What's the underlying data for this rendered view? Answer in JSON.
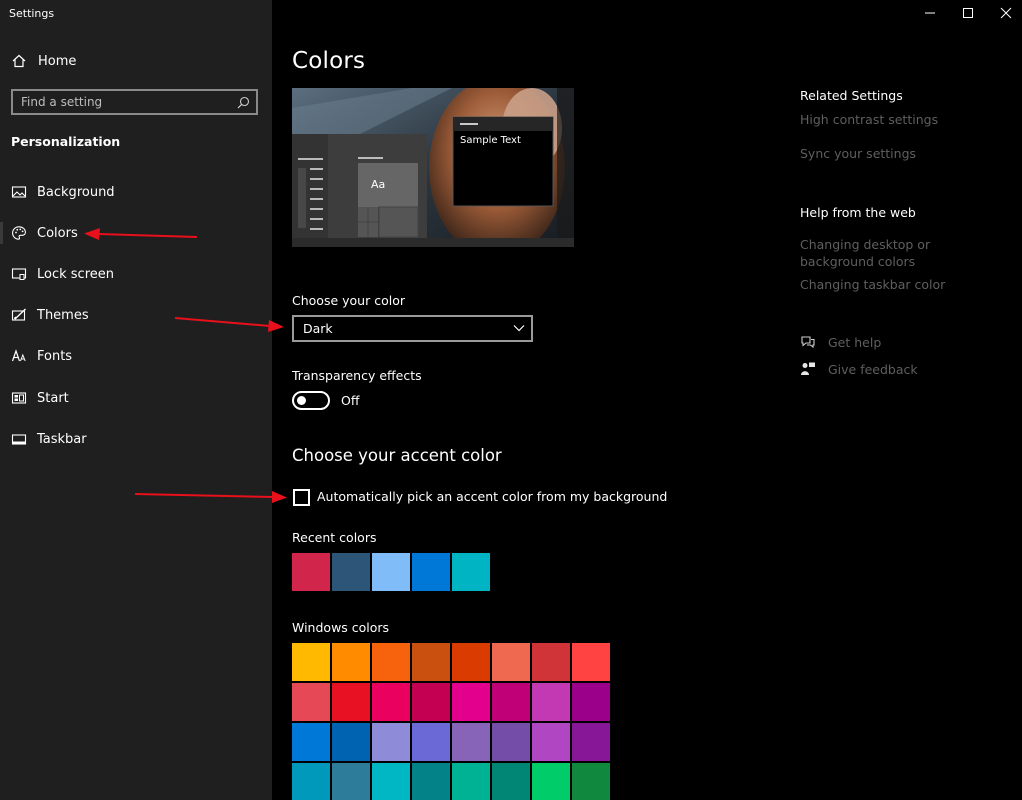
{
  "window": {
    "title": "Settings",
    "controls": [
      "minimize",
      "maximize",
      "close"
    ]
  },
  "sidebar": {
    "home_label": "Home",
    "search_placeholder": "Find a setting",
    "section_label": "Personalization",
    "items": [
      {
        "label": "Background",
        "icon": "image-icon"
      },
      {
        "label": "Colors",
        "icon": "palette-icon",
        "selected": true
      },
      {
        "label": "Lock screen",
        "icon": "lock-screen-icon"
      },
      {
        "label": "Themes",
        "icon": "brush-icon"
      },
      {
        "label": "Fonts",
        "icon": "fonts-icon"
      },
      {
        "label": "Start",
        "icon": "start-icon"
      },
      {
        "label": "Taskbar",
        "icon": "taskbar-icon"
      }
    ]
  },
  "main": {
    "title": "Colors",
    "preview": {
      "sample_text": "Sample Text",
      "tile_label": "Aa"
    },
    "choose_color": {
      "label": "Choose your color",
      "value": "Dark"
    },
    "transparency": {
      "label": "Transparency effects",
      "state": "Off"
    },
    "accent": {
      "heading": "Choose your accent color",
      "auto_pick_label": "Automatically pick an accent color from my background",
      "auto_pick_checked": false
    },
    "recent_colors": {
      "label": "Recent colors",
      "colors": [
        "#d1254b",
        "#2d5577",
        "#7fbcf8",
        "#0078d7",
        "#00b4c4"
      ]
    },
    "windows_colors": {
      "label": "Windows colors",
      "rows": [
        [
          "#ffb900",
          "#ff8c00",
          "#f7630c",
          "#ca5010",
          "#da3b01",
          "#ef6950",
          "#d13438",
          "#ff4343"
        ],
        [
          "#e74856",
          "#e81123",
          "#ea005e",
          "#c30052",
          "#e3008c",
          "#bf0077",
          "#c239b3",
          "#9a0089"
        ],
        [
          "#0078d7",
          "#0063b1",
          "#8e8cd8",
          "#6b69d6",
          "#8764b8",
          "#744da9",
          "#b146c2",
          "#881798"
        ],
        [
          "#0099bc",
          "#2d7d9a",
          "#00b7c3",
          "#038387",
          "#00b294",
          "#018574",
          "#00cc6a",
          "#10893e"
        ]
      ]
    }
  },
  "right": {
    "related_heading": "Related Settings",
    "related_links": [
      "High contrast settings",
      "Sync your settings"
    ],
    "help_heading": "Help from the web",
    "help_links": [
      "Changing desktop or background colors",
      "Changing taskbar color"
    ],
    "get_help": "Get help",
    "give_feedback": "Give feedback"
  },
  "colors": {
    "sidebar_bg": "#1f1f1f",
    "main_bg": "#000000",
    "annotation_arrow": "#e8101a"
  }
}
